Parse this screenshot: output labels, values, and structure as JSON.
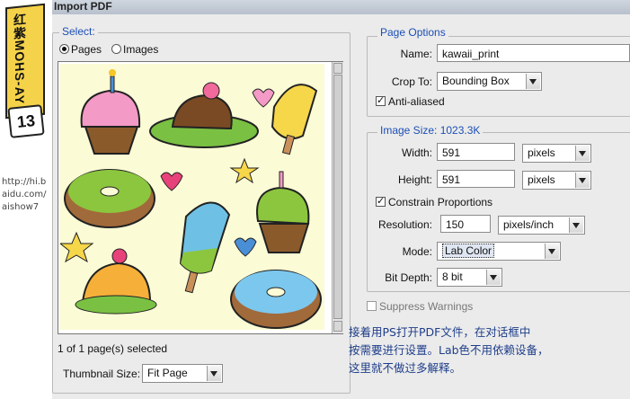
{
  "tutorial": {
    "tag_text": "红紫MOHS-AY",
    "step_number": "13",
    "url_lines": [
      "http://hi.b",
      "aidu.com/",
      "aishow7"
    ]
  },
  "dialog": {
    "title": "Import PDF",
    "select": {
      "title": "Select:",
      "options": [
        "Pages",
        "Images"
      ],
      "selected": "Pages",
      "status": "1 of 1 page(s) selected"
    },
    "thumbnail_size": {
      "label": "Thumbnail Size:",
      "value": "Fit Page"
    },
    "page_options": {
      "title": "Page Options",
      "name_label": "Name:",
      "name_value": "kawaii_print",
      "crop_label": "Crop To:",
      "crop_value": "Bounding Box",
      "anti_aliased_label": "Anti-aliased",
      "anti_aliased": true
    },
    "image_size": {
      "title": "Image Size: 1023.3K",
      "width_label": "Width:",
      "width_value": "591",
      "width_unit": "pixels",
      "height_label": "Height:",
      "height_value": "591",
      "height_unit": "pixels",
      "constrain_label": "Constrain Proportions",
      "constrain": true,
      "resolution_label": "Resolution:",
      "resolution_value": "150",
      "resolution_unit": "pixels/inch",
      "mode_label": "Mode:",
      "mode_value": "Lab Color",
      "bitdepth_label": "Bit Depth:",
      "bitdepth_value": "8 bit"
    },
    "suppress_warnings_label": "Suppress Warnings",
    "suppress_warnings": false
  },
  "caption_lines": [
    "接着用PS打开PDF文件，在对话框中",
    "按需要进行设置。Lab色不用依赖设备，",
    "这里就不做过多解释。"
  ],
  "colors": {
    "accent_blue": "#1c4fb5",
    "caption_blue": "#1e3e8a",
    "tag_yellow": "#f4d24a",
    "thumb_bg": "#fbfbd6"
  }
}
